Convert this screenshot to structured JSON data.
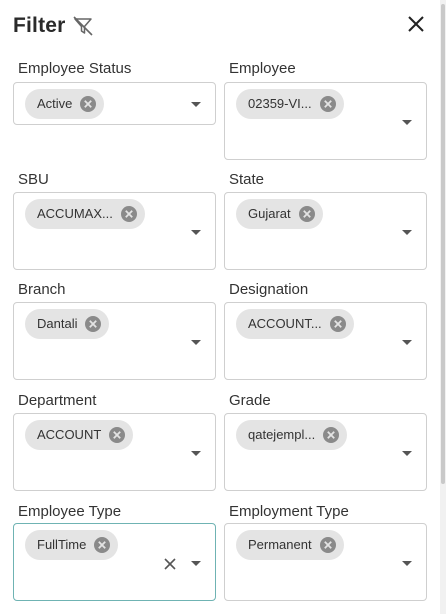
{
  "header": {
    "title": "Filter"
  },
  "filters": {
    "employee_status": {
      "label": "Employee Status",
      "chip": "Active"
    },
    "employee": {
      "label": "Employee",
      "chip": "02359-VI..."
    },
    "sbu": {
      "label": "SBU",
      "chip": "ACCUMAX..."
    },
    "state": {
      "label": "State",
      "chip": "Gujarat"
    },
    "branch": {
      "label": "Branch",
      "chip": "Dantali"
    },
    "designation": {
      "label": "Designation",
      "chip": "ACCOUNT..."
    },
    "department": {
      "label": "Department",
      "chip": "ACCOUNT"
    },
    "grade": {
      "label": "Grade",
      "chip": "qatejempl..."
    },
    "employee_type": {
      "label": "Employee Type",
      "chip": "FullTime"
    },
    "employment_type": {
      "label": "Employment Type",
      "chip": "Permanent"
    }
  },
  "colors": {
    "chip_bg": "#e4e4e4",
    "border": "#cfcfcf",
    "focus_border": "#6fb3b3"
  },
  "icons": {
    "clear_filter": "filter-clear-icon",
    "close": "close-icon",
    "chip_remove": "circle-x-icon",
    "dropdown": "caret-down-icon"
  }
}
